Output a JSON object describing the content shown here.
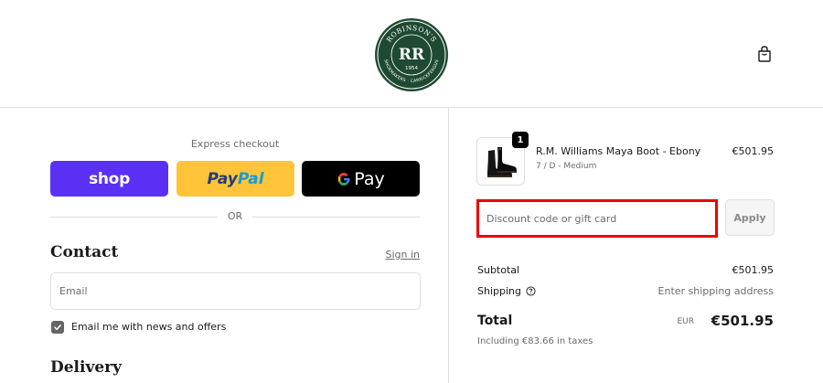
{
  "header": {
    "logo": {
      "name": "ROBINSON'S",
      "monogram": "RR",
      "year": "1954",
      "tagline": "SHOEMAKERS · CARRICKFERGUS"
    },
    "cart_icon": "shopping-bag-icon"
  },
  "express": {
    "label": "Express checkout",
    "buttons": {
      "shop": "shop",
      "paypal_part1": "Pay",
      "paypal_part2": "Pal",
      "gpay_g": "G",
      "gpay_text": "Pay"
    },
    "or": "OR"
  },
  "contact": {
    "title": "Contact",
    "sign_in": "Sign in",
    "email_placeholder": "Email",
    "checkbox_label": "Email me with news and offers"
  },
  "delivery": {
    "title": "Delivery"
  },
  "summary": {
    "item": {
      "name": "R.M. Williams Maya Boot - Ebony",
      "variant": "7 / D - Medium",
      "price": "€501.95",
      "quantity": "1"
    },
    "discount_placeholder": "Discount code or gift card",
    "apply": "Apply",
    "subtotal_label": "Subtotal",
    "subtotal_value": "€501.95",
    "shipping_label": "Shipping",
    "shipping_value": "Enter shipping address",
    "total_label": "Total",
    "currency": "EUR",
    "total_value": "€501.95",
    "tax_note": "Including €83.66 in taxes"
  },
  "colors": {
    "shop_purple": "#5a31f4",
    "paypal_yellow": "#ffc439",
    "gpay_black": "#000000",
    "highlight_red": "#ee0000",
    "logo_green": "#1f4a32"
  }
}
